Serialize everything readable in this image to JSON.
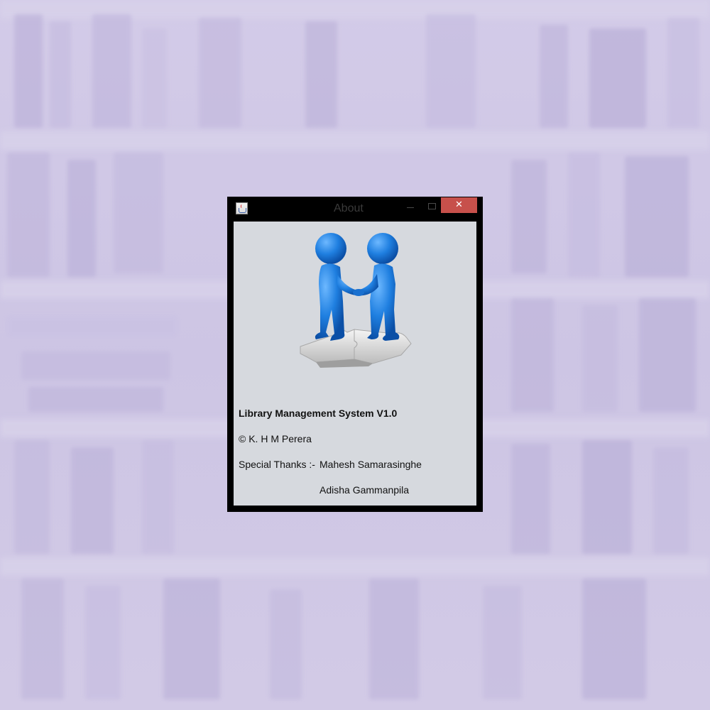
{
  "window": {
    "title": "About",
    "close_glyph": "✕"
  },
  "about": {
    "product": "Library Management System V1.0",
    "copyright": "© K. H M Perera",
    "thanks_label": "Special Thanks :-",
    "thanks_names": [
      "Mahesh Samarasinghe",
      "Adisha Gammanpila"
    ]
  },
  "illustration": {
    "icon": "handshake-puzzle-icon",
    "figure_color": "#1f7fe0",
    "puzzle_color": "#e8e8e8"
  },
  "colors": {
    "close_button": "#c7504b",
    "dialog_content": "#d6d9de",
    "frame": "#000000"
  }
}
